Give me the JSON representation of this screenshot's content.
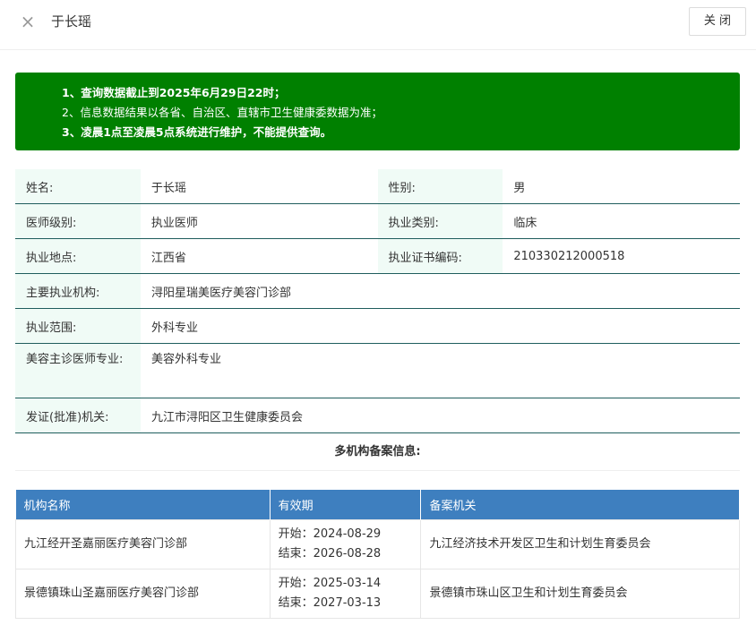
{
  "dialog": {
    "title": "于长瑶",
    "close_icon": "×",
    "close_button": "关 闭"
  },
  "notice": {
    "line1": "1、查询数据截止到2025年6月29日22时；",
    "line2": "2、信息数据结果以各省、自治区、直辖市卫生健康委数据为准；",
    "line3": "3、凌晨1点至凌晨5点系统进行维护，不能提供查询。",
    "bg_color": "#008000"
  },
  "info": {
    "name_label": "姓名:",
    "name_value": "于长瑶",
    "gender_label": "性别:",
    "gender_value": "男",
    "level_label": "医师级别:",
    "level_value": "执业医师",
    "category_label": "执业类别:",
    "category_value": "临床",
    "location_label": "执业地点:",
    "location_value": "江西省",
    "cert_label": "执业证书编码:",
    "cert_value": "210330212000518",
    "org_label": "主要执业机构:",
    "org_value": "浔阳星瑞美医疗美容门诊部",
    "scope_label": "执业范围:",
    "scope_value": "外科专业",
    "cosmetic_label": "美容主诊医师专业:",
    "cosmetic_value": "美容外科专业",
    "issuer_label": "发证(批准)机关:",
    "issuer_value": "九江市浔阳区卫生健康委员会"
  },
  "multi": {
    "title": "多机构备案信息:",
    "headers": [
      "机构名称",
      "有效期",
      "备案机关"
    ],
    "rows": [
      {
        "name": "九江经开圣嘉丽医疗美容门诊部",
        "start": "开始：2024-08-29",
        "end": "结束：2026-08-28",
        "authority": "九江经济技术开发区卫生和计划生育委员会"
      },
      {
        "name": "景德镇珠山圣嘉丽医疗美容门诊部",
        "start": "开始：2025-03-14",
        "end": "结束：2027-03-13",
        "authority": "景德镇市珠山区卫生和计划生育委员会"
      }
    ],
    "header_color": "#3e7fbf"
  }
}
